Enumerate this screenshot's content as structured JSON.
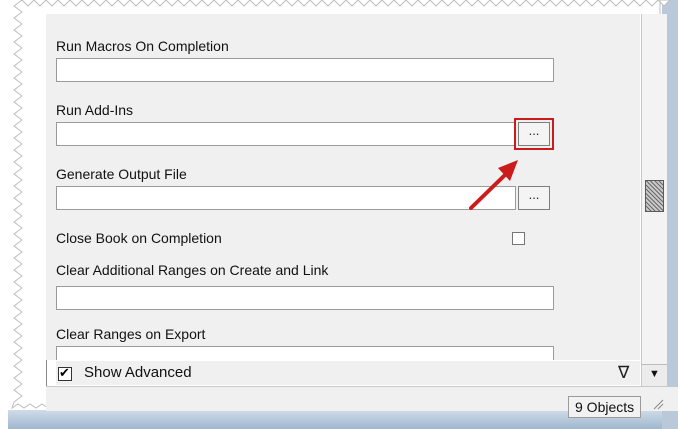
{
  "properties": [
    {
      "label": "Run Macros On Completion",
      "value": ""
    },
    {
      "label": "Run Add-Ins",
      "value": "",
      "button_label": "..."
    },
    {
      "label": "Generate Output File",
      "value": "",
      "button_label": "..."
    },
    {
      "label": "Close Book on Completion",
      "checked": false
    },
    {
      "label": "Clear Additional Ranges on Create and Link",
      "value": ""
    },
    {
      "label": "Clear Ranges on Export",
      "value": ""
    }
  ],
  "show_advanced": {
    "label": "Show Advanced",
    "checked": true,
    "check_glyph": "✔",
    "filter_glyph": "∇"
  },
  "scrollbar": {
    "down_glyph": "▼"
  },
  "status_bar": {
    "object_count": "9 Objects"
  },
  "colors": {
    "highlight": "#cc1b1b",
    "arrow": "#cc1b1b",
    "shadow": "#9fb7cf"
  },
  "icons": {
    "annotation_arrow": "red-arrow-icon",
    "filter": "filter-icon",
    "resize_grip": "resize-grip-icon"
  }
}
